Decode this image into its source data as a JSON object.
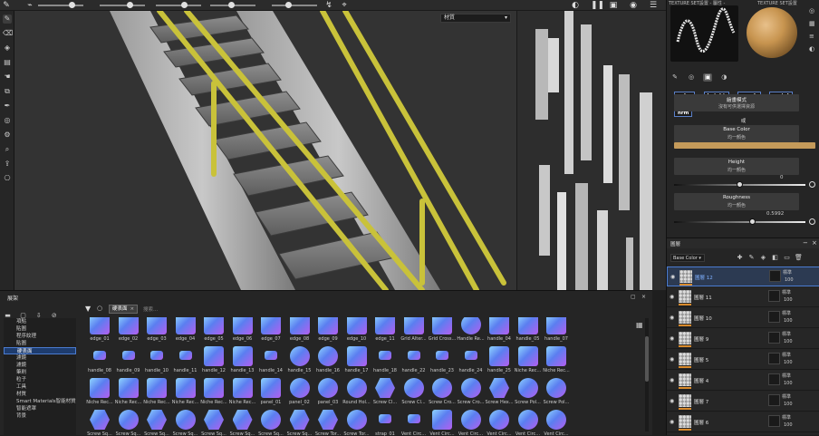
{
  "viewport": {
    "material_dropdown": "材質",
    "dropdown_arrow": "▾"
  },
  "texture_set": {
    "name_1": "TEXTURE SET設置 - 屬性 -",
    "name_2": "TEXTURE SET設置"
  },
  "properties": {
    "channels": [
      "color",
      "height",
      "rough",
      "metal",
      "nrm"
    ],
    "paint_mode_label": "繪畫模式",
    "paint_mode_sub": "沒有可供選擇資源",
    "or_label": "或",
    "base_color": {
      "title": "Base Color",
      "sub": "均一顏色",
      "color": "#c49a5a"
    },
    "height": {
      "title": "Height",
      "sub": "均一顏色",
      "value": "0",
      "level": 0.5
    },
    "roughness": {
      "title": "Roughness",
      "sub": "均一顏色",
      "value": "0.5992",
      "level": 0.6
    }
  },
  "layers": {
    "title": "圖層",
    "channel_select": "Base Color",
    "items": [
      {
        "name": "圖層 12",
        "blend": "標準",
        "opacity": "100",
        "selected": true
      },
      {
        "name": "圖層 11",
        "blend": "標準",
        "opacity": "100",
        "selected": false
      },
      {
        "name": "圖層 10",
        "blend": "標準",
        "opacity": "100",
        "selected": false
      },
      {
        "name": "圖層 9",
        "blend": "標準",
        "opacity": "100",
        "selected": false
      },
      {
        "name": "圖層 5",
        "blend": "標準",
        "opacity": "100",
        "selected": false
      },
      {
        "name": "圖層 4",
        "blend": "標準",
        "opacity": "100",
        "selected": false
      },
      {
        "name": "圖層 7",
        "blend": "標準",
        "opacity": "100",
        "selected": false
      },
      {
        "name": "圖層 6",
        "blend": "標準",
        "opacity": "100",
        "selected": false
      }
    ]
  },
  "shelf": {
    "title": "展架",
    "categories": [
      "項點",
      "貼圖",
      "程序紋理",
      "貼圖",
      "硬表面",
      "濾鏡",
      "濾鏡",
      "筆刷",
      "粒子",
      "工具",
      "材質",
      "Smart Materials智能材質",
      "智能遮罩",
      "背景"
    ],
    "selected_category": 4,
    "filter_chip": "硬表面",
    "filter_close": "×",
    "search_placeholder": "搜索...",
    "items": [
      {
        "label": "edge_01",
        "shape": "rect"
      },
      {
        "label": "edge_02",
        "shape": "rect"
      },
      {
        "label": "edge_03",
        "shape": "rect"
      },
      {
        "label": "edge_04",
        "shape": "rect"
      },
      {
        "label": "edge_05",
        "shape": "rect"
      },
      {
        "label": "edge_06",
        "shape": "rect"
      },
      {
        "label": "edge_07",
        "shape": "rect"
      },
      {
        "label": "edge_08",
        "shape": "rect"
      },
      {
        "label": "edge_09",
        "shape": "rect"
      },
      {
        "label": "edge_10",
        "shape": "rect"
      },
      {
        "label": "edge_11",
        "shape": "rect"
      },
      {
        "label": "Grid Alter...",
        "shape": "rect"
      },
      {
        "label": "Grid Cross...",
        "shape": "rect"
      },
      {
        "label": "Handle Re...",
        "shape": "round"
      },
      {
        "label": "handle_04",
        "shape": "rect"
      },
      {
        "label": "handle_05",
        "shape": "rect"
      },
      {
        "label": "handle_07",
        "shape": "rect"
      },
      {
        "label": "handle_08",
        "shape": "small"
      },
      {
        "label": "handle_09",
        "shape": "small"
      },
      {
        "label": "handle_10",
        "shape": "small"
      },
      {
        "label": "handle_11",
        "shape": "small"
      },
      {
        "label": "handle_12",
        "shape": "rect"
      },
      {
        "label": "handle_13",
        "shape": "rect"
      },
      {
        "label": "handle_14",
        "shape": "small"
      },
      {
        "label": "handle_15",
        "shape": "round"
      },
      {
        "label": "handle_16",
        "shape": "round"
      },
      {
        "label": "handle_17",
        "shape": "rect"
      },
      {
        "label": "handle_18",
        "shape": "small"
      },
      {
        "label": "handle_22",
        "shape": "small"
      },
      {
        "label": "handle_23",
        "shape": "small"
      },
      {
        "label": "handle_24",
        "shape": "small"
      },
      {
        "label": "handle_25",
        "shape": "rect"
      },
      {
        "label": "Niche Rec...",
        "shape": "rect"
      },
      {
        "label": "Niche Rec...",
        "shape": "rect"
      },
      {
        "label": "Niche Rec...",
        "shape": "rect"
      },
      {
        "label": "Niche Rec...",
        "shape": "rect"
      },
      {
        "label": "Niche Rec...",
        "shape": "rect"
      },
      {
        "label": "Niche Rec...",
        "shape": "rect"
      },
      {
        "label": "Niche Rec...",
        "shape": "rect"
      },
      {
        "label": "Niche Rec...",
        "shape": "rect"
      },
      {
        "label": "panel_01",
        "shape": "rect"
      },
      {
        "label": "panel_02",
        "shape": "round"
      },
      {
        "label": "panel_03",
        "shape": "round"
      },
      {
        "label": "Round Hol...",
        "shape": "round"
      },
      {
        "label": "Screw Cl...",
        "shape": "hex"
      },
      {
        "label": "Screw Cl...",
        "shape": "round"
      },
      {
        "label": "Screw Cro...",
        "shape": "round"
      },
      {
        "label": "Screw Cro...",
        "shape": "round"
      },
      {
        "label": "Screw Hex...",
        "shape": "hex"
      },
      {
        "label": "Screw Pol...",
        "shape": "round"
      },
      {
        "label": "Screw Pol...",
        "shape": "round"
      },
      {
        "label": "Screw Sq...",
        "shape": "hex"
      },
      {
        "label": "Screw Sq...",
        "shape": "round"
      },
      {
        "label": "Screw Sq...",
        "shape": "hex"
      },
      {
        "label": "Screw Sq...",
        "shape": "round"
      },
      {
        "label": "Screw Sq...",
        "shape": "hex"
      },
      {
        "label": "Screw Sq...",
        "shape": "hex"
      },
      {
        "label": "Screw Sq...",
        "shape": "round"
      },
      {
        "label": "Screw Sq...",
        "shape": "hex"
      },
      {
        "label": "Screw Tor...",
        "shape": "hex"
      },
      {
        "label": "Screw Tor...",
        "shape": "round"
      },
      {
        "label": "strap_01",
        "shape": "small"
      },
      {
        "label": "Vent Circ...",
        "shape": "small"
      },
      {
        "label": "Vent Circ...",
        "shape": "rect"
      },
      {
        "label": "Vent Circ...",
        "shape": "round"
      },
      {
        "label": "Vent Circ...",
        "shape": "round"
      },
      {
        "label": "Vent Circ...",
        "shape": "round"
      },
      {
        "label": "Vent Circ...",
        "shape": "round"
      }
    ]
  },
  "colors": {
    "accent": "#4a7bd0",
    "rail": "#c9c23a",
    "base_color": "#c49a5a"
  }
}
